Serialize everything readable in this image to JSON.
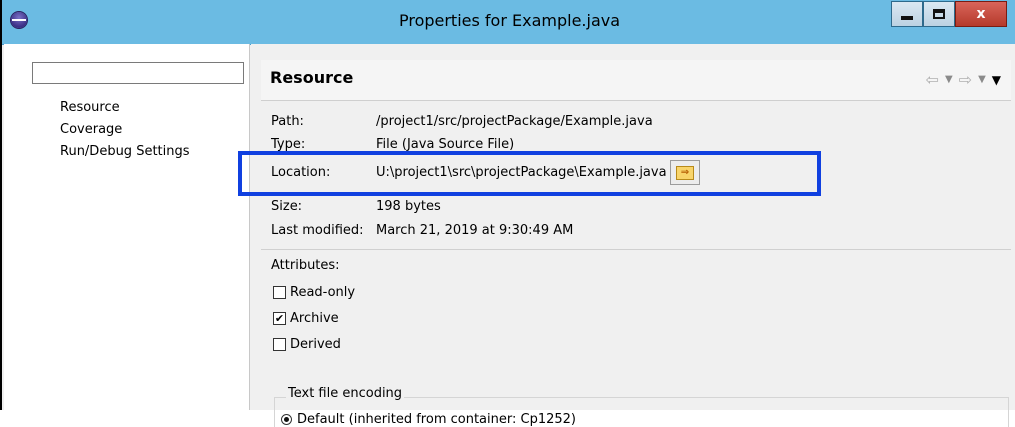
{
  "window": {
    "title": "Properties for Example.java",
    "controls": {
      "minimize_icon": "minimize-icon",
      "maximize_icon": "maximize-icon",
      "close_label": "x"
    }
  },
  "sidebar": {
    "filter_placeholder": "",
    "items": [
      {
        "label": "Resource"
      },
      {
        "label": "Coverage"
      },
      {
        "label": "Run/Debug Settings"
      }
    ]
  },
  "page": {
    "title": "Resource",
    "nav_icons": [
      "back-arrow-icon",
      "dropdown-icon",
      "forward-arrow-icon",
      "dropdown-icon",
      "view-menu-icon"
    ]
  },
  "resource": {
    "path": {
      "label": "Path:",
      "value": "/project1/src/projectPackage/Example.java"
    },
    "type": {
      "label": "Type:",
      "value": "File  (Java Source File)"
    },
    "location": {
      "label": "Location:",
      "value": "U:\\project1\\src\\projectPackage\\Example.java",
      "highlight_color": "#1040e0"
    },
    "size": {
      "label": "Size:",
      "value": "198  bytes"
    },
    "modified": {
      "label": "Last modified:",
      "value": "March 21, 2019 at 9:30:49 AM"
    }
  },
  "attributes": {
    "label": "Attributes:",
    "items": [
      {
        "label": "Read-only",
        "checked": false
      },
      {
        "label": "Archive",
        "checked": true
      },
      {
        "label": "Derived",
        "checked": false
      }
    ]
  },
  "encoding": {
    "group_label": "Text file encoding",
    "default_option": "Default (inherited from container: Cp1252)",
    "selected": true
  }
}
